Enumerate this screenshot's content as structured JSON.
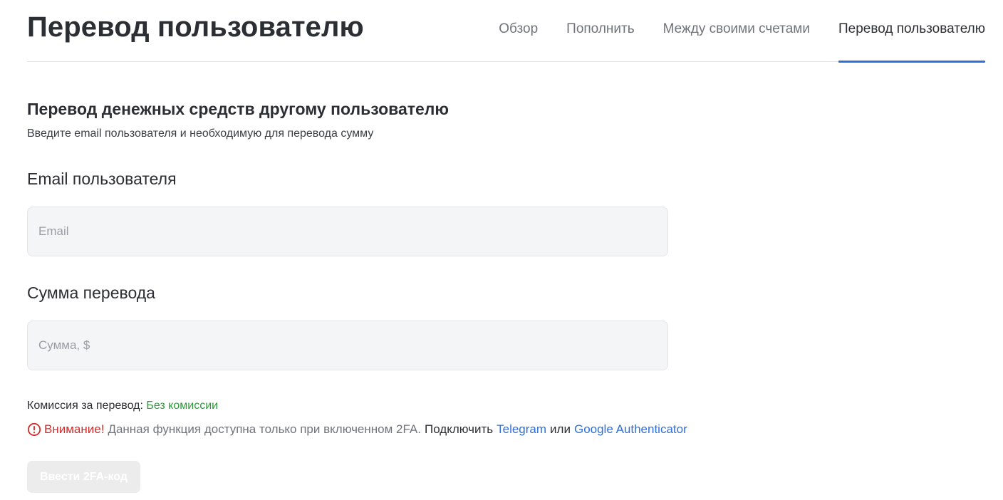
{
  "header": {
    "title": "Перевод пользователю",
    "tabs": [
      {
        "label": "Обзор",
        "active": false
      },
      {
        "label": "Пополнить",
        "active": false
      },
      {
        "label": "Между своими счетами",
        "active": false
      },
      {
        "label": "Перевод пользователю",
        "active": true
      }
    ]
  },
  "form": {
    "section_title": "Перевод денежных средств другому пользователю",
    "section_subtitle": "Введите email пользователя и необходимую для перевода сумму",
    "email_label": "Email пользователя",
    "email_placeholder": "Email",
    "email_value": "",
    "amount_label": "Сумма перевода",
    "amount_placeholder": "Сумма, $",
    "amount_value": "",
    "fee_label": "Комиссия за перевод:",
    "fee_value": "Без комиссии"
  },
  "warning": {
    "icon": "alert-circle-icon",
    "title": "Внимание!",
    "text": "Данная функция доступна только при включенном 2FA.",
    "connect": "Подключить",
    "link_telegram": "Telegram",
    "or": "или",
    "link_google": "Google Authenticator"
  },
  "submit_label": "Ввести 2FA-код",
  "colors": {
    "accent": "#2f6fdc",
    "success": "#2e9a3a",
    "danger": "#d22c2c",
    "button_disabled": "#ececec"
  }
}
